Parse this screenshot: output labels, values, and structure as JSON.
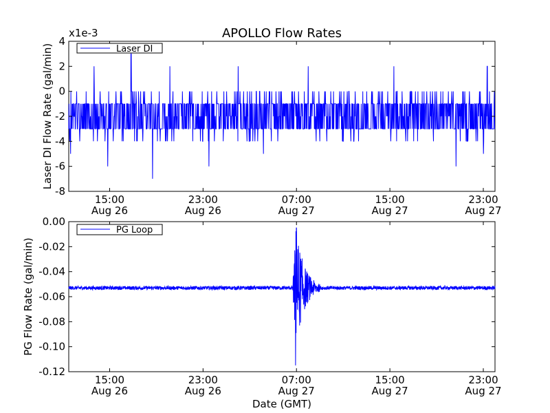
{
  "chart_data": {
    "title": "APOLLO Flow Rates",
    "xlabel": "Date (GMT)",
    "x_range": [
      "2012-08-26 11:30",
      "2012-08-28 00:00"
    ],
    "x_ticks": [
      {
        "time": "15:00",
        "date": "Aug 26"
      },
      {
        "time": "23:00",
        "date": "Aug 26"
      },
      {
        "time": "07:00",
        "date": "Aug 27"
      },
      {
        "time": "15:00",
        "date": "Aug 27"
      },
      {
        "time": "23:00",
        "date": "Aug 27"
      }
    ],
    "panels": [
      {
        "type": "line",
        "ylabel": "Laser DI Flow Rate (gal/min)",
        "scale_note": "x1e-3",
        "ylim": [
          -8,
          4
        ],
        "y_ticks": [
          "4",
          "2",
          "0",
          "-2",
          "-4",
          "-6",
          "-8"
        ],
        "series": [
          {
            "name": "Laser DI",
            "color": "#0000ff",
            "typical_range": [
              -4,
              0
            ],
            "center_band": [
              -3,
              -1
            ],
            "spikes": [
              {
                "x": "2012-08-26 11:40",
                "y": -5
              },
              {
                "x": "2012-08-26 13:40",
                "y": 2
              },
              {
                "x": "2012-08-26 14:50",
                "y": -6
              },
              {
                "x": "2012-08-26 16:50",
                "y": 3
              },
              {
                "x": "2012-08-26 18:40",
                "y": -7
              },
              {
                "x": "2012-08-26 20:10",
                "y": 2
              },
              {
                "x": "2012-08-26 23:30",
                "y": -6
              },
              {
                "x": "2012-08-27 02:00",
                "y": 2
              },
              {
                "x": "2012-08-27 04:10",
                "y": -5
              },
              {
                "x": "2012-08-27 08:00",
                "y": 2
              },
              {
                "x": "2012-08-27 15:20",
                "y": 2
              },
              {
                "x": "2012-08-27 20:40",
                "y": -6
              },
              {
                "x": "2012-08-27 23:20",
                "y": 2
              },
              {
                "x": "2012-08-27 23:00",
                "y": -5
              }
            ]
          }
        ],
        "legend": "upper-left"
      },
      {
        "type": "line",
        "ylabel": "PG Flow Rate (gal/min)",
        "ylim": [
          -0.12,
          0.0
        ],
        "y_ticks": [
          "0.00",
          "-0.02",
          "-0.04",
          "-0.06",
          "-0.08",
          "-0.10",
          "-0.12"
        ],
        "series": [
          {
            "name": "PG Loop",
            "color": "#0000ff",
            "baseline": -0.053,
            "noise": 0.0015,
            "disturbance": {
              "start": "2012-08-27 06:40",
              "end": "2012-08-27 09:00",
              "min": -0.115,
              "max": -0.005
            }
          }
        ],
        "legend": "upper-left"
      }
    ]
  }
}
